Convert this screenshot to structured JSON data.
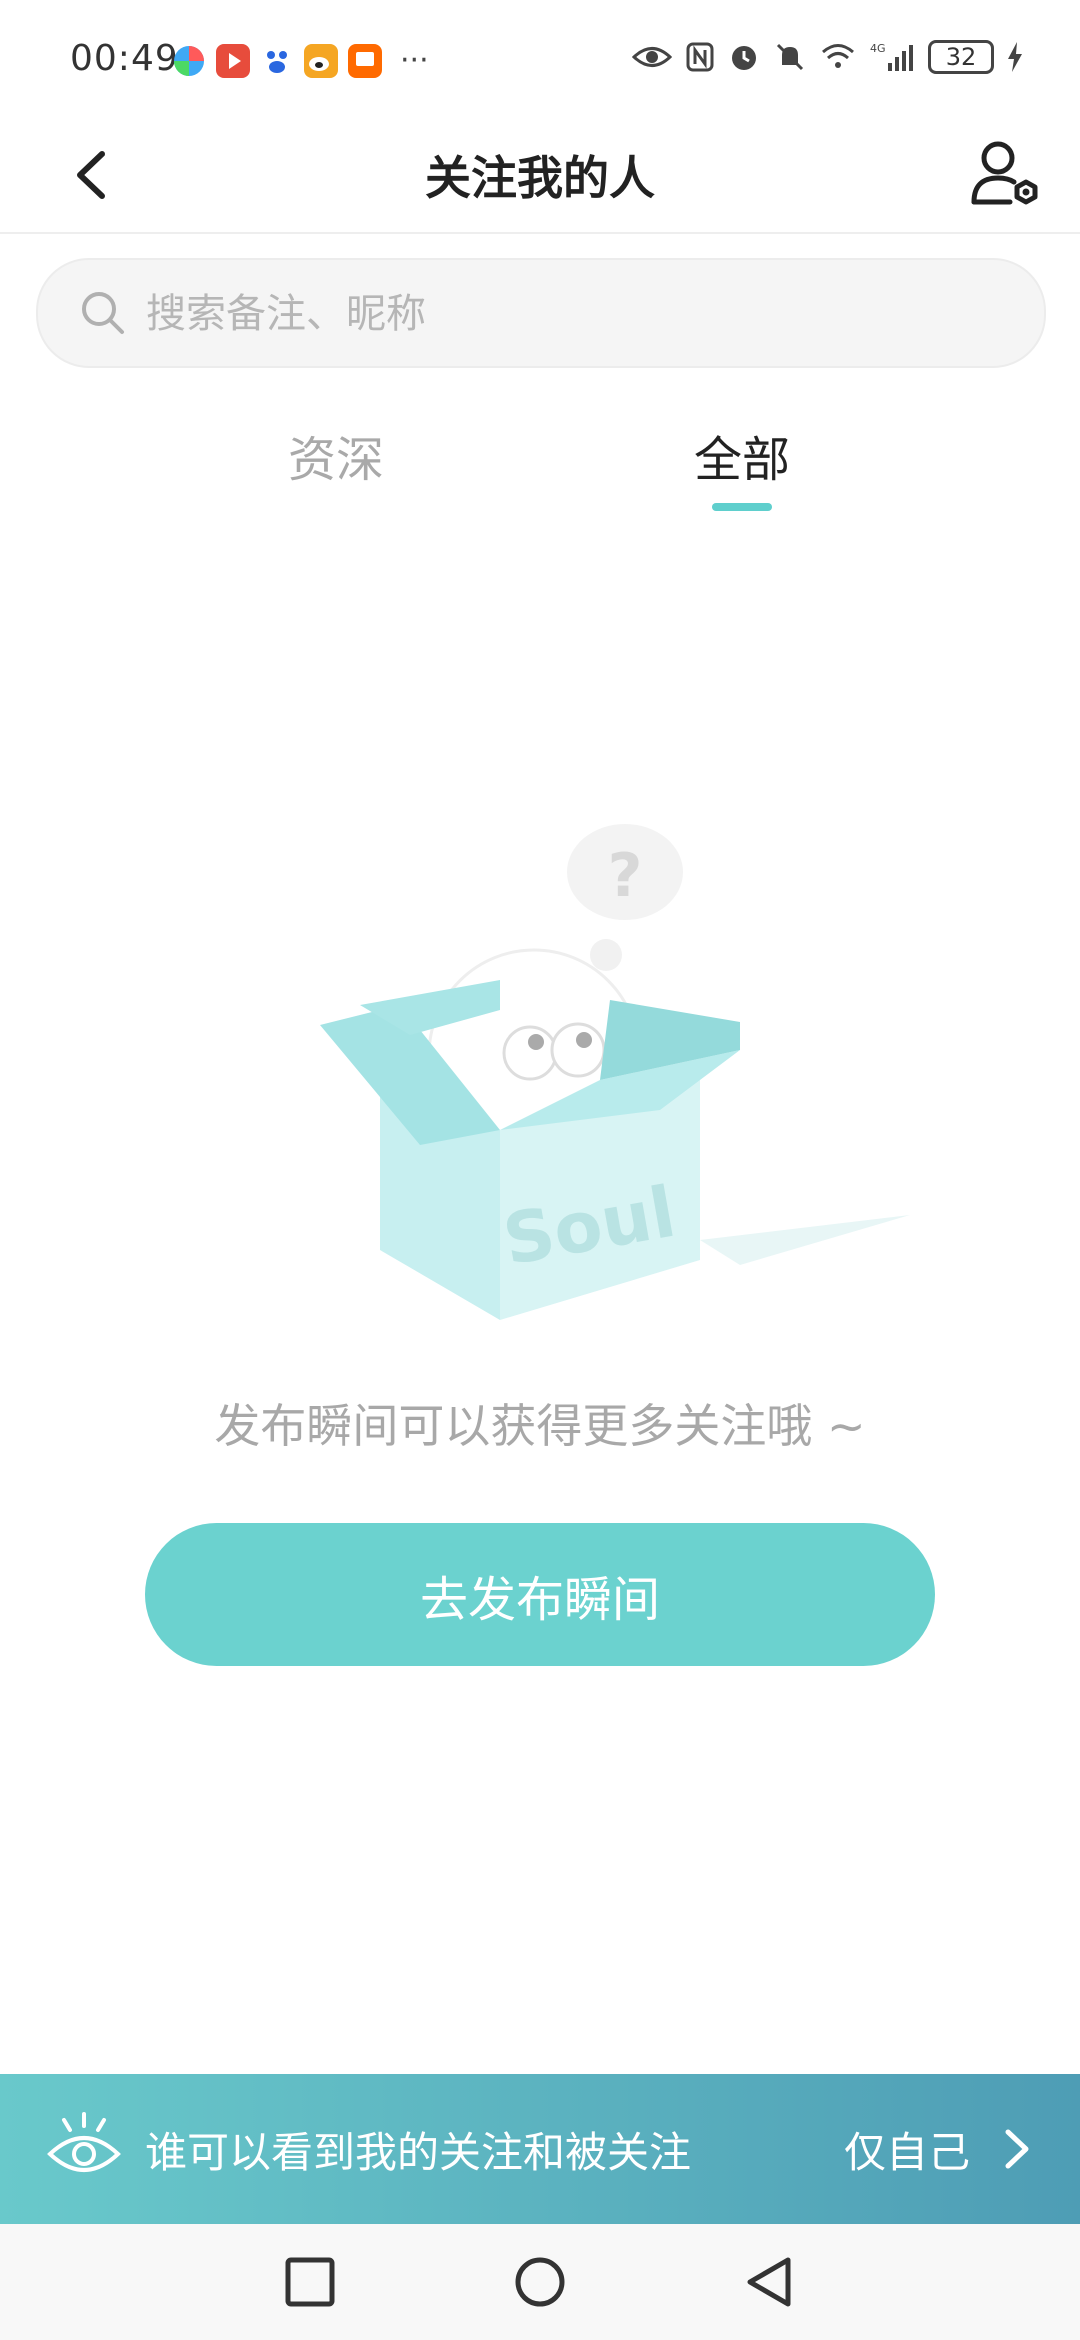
{
  "status_bar": {
    "time": "00:49",
    "app_icons": [
      {
        "name": "colorful-app-icon",
        "color": "#3fa9f5"
      },
      {
        "name": "video-app-icon",
        "color": "#e74c3c"
      },
      {
        "name": "baidu-icon",
        "color": "#2a67e0"
      },
      {
        "name": "weibo-icon",
        "color": "#f5a623"
      },
      {
        "name": "taobao-icon",
        "color": "#ff6a00"
      }
    ],
    "more": "···",
    "battery": "32",
    "network": "4G"
  },
  "header": {
    "title": "关注我的人"
  },
  "search": {
    "placeholder": "搜索备注、昵称"
  },
  "tabs": {
    "senior": "资深",
    "all": "全部",
    "active": "all",
    "accent_color": "#5fcfcd"
  },
  "empty_state": {
    "illustration_text": "Soul",
    "message": "发布瞬间可以获得更多关注哦 ~",
    "button_label": "去发布瞬间"
  },
  "privacy_banner": {
    "label": "谁可以看到我的关注和被关注",
    "value": "仅自己"
  },
  "colors": {
    "accent": "#6bd2cf",
    "banner_start": "#69c9cb",
    "banner_end": "#4e9db5"
  }
}
